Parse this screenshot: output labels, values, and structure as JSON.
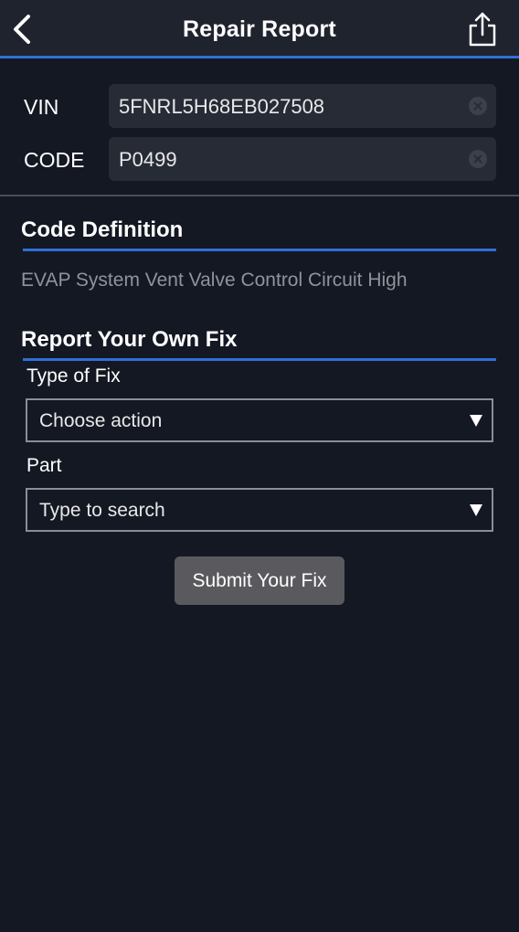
{
  "header": {
    "title": "Repair Report",
    "back_icon": "chevron-left-icon",
    "share_icon": "share-icon"
  },
  "fields": {
    "vin": {
      "label": "VIN",
      "value": "5FNRL5H68EB027508"
    },
    "code": {
      "label": "CODE",
      "value": "P0499"
    }
  },
  "definition": {
    "title": "Code Definition",
    "text": "EVAP System Vent Valve Control Circuit High"
  },
  "report": {
    "title": "Report Your Own Fix",
    "type_label": "Type of Fix",
    "type_value": "Choose action",
    "part_label": "Part",
    "part_value": "Type to search",
    "submit_label": "Submit Your Fix"
  },
  "colors": {
    "background": "#141822",
    "header": "#1f232d",
    "accent": "#2f6fd6",
    "button": "#5a5a5e"
  }
}
